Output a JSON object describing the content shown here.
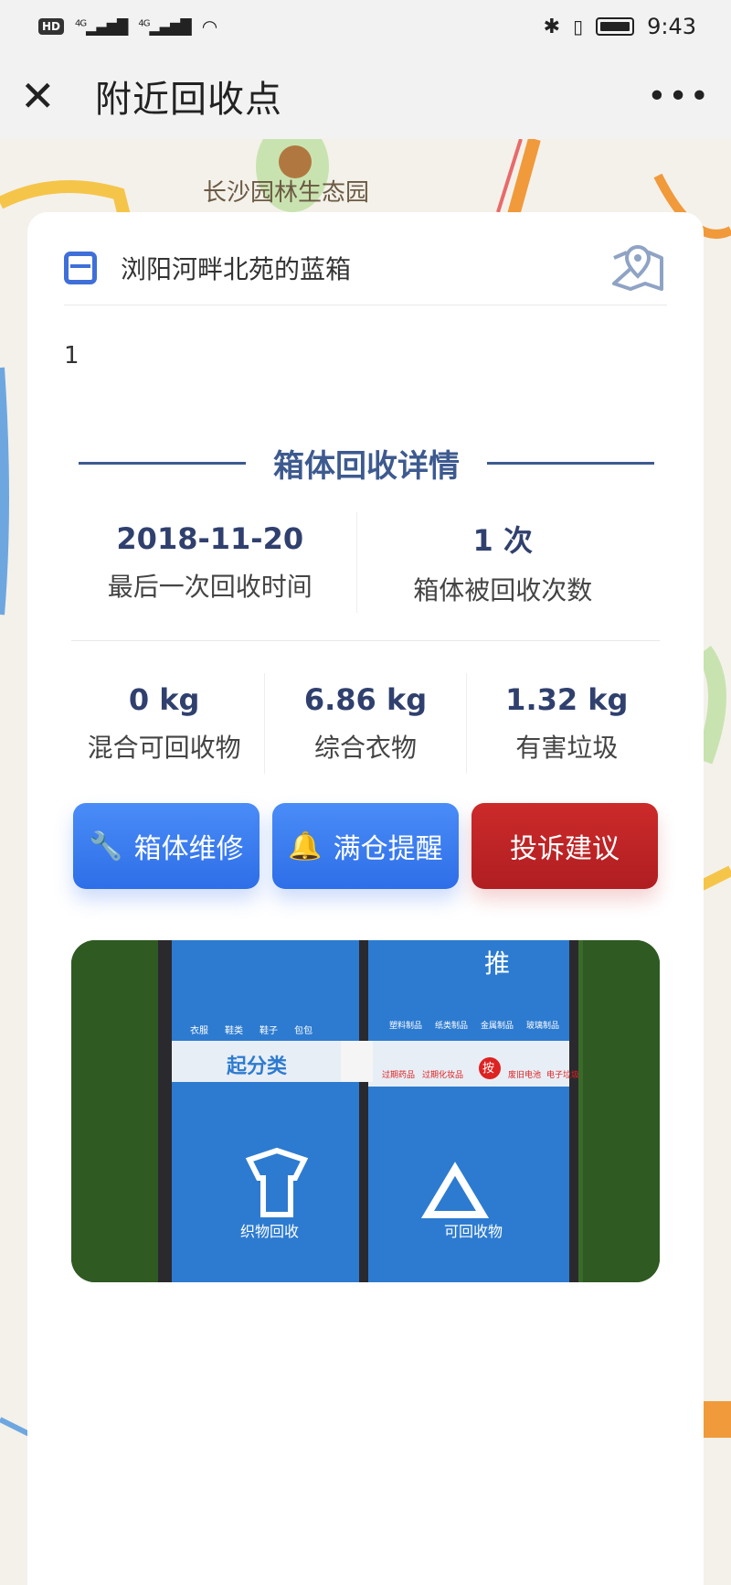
{
  "statusbar": {
    "hd": "HD",
    "signal1": "4G",
    "signal2": "4G",
    "time": "9:43"
  },
  "navbar": {
    "close_icon": "close-icon",
    "title": "附近回收点",
    "more_icon": "more-icon"
  },
  "map": {
    "label_top": "长沙园林生态园"
  },
  "card": {
    "title": "浏阳河畔北苑的蓝箱",
    "description": "1",
    "section_title": "箱体回收详情",
    "stats_primary": [
      {
        "value": "2018-11-20",
        "label": "最后一次回收时间"
      },
      {
        "value": "1 次",
        "label": "箱体被回收次数"
      }
    ],
    "stats_weights": [
      {
        "value": "0 kg",
        "label": "混合可回收物"
      },
      {
        "value": "6.86 kg",
        "label": "综合衣物"
      },
      {
        "value": "1.32 kg",
        "label": "有害垃圾"
      }
    ],
    "buttons": {
      "repair": "箱体维修",
      "full_alert": "满仓提醒",
      "complaint": "投诉建议"
    },
    "photo": {
      "left_panel_text": "起分类",
      "left_bin_label": "织物回收",
      "right_bin_label": "可回收物",
      "push_label": "推",
      "press_label": "按",
      "left_icons": [
        "衣服",
        "鞋类",
        "鞋子",
        "包包"
      ],
      "right_icons": [
        "塑料制品",
        "纸类制品",
        "金属制品",
        "玻璃制品"
      ],
      "hazard_icons": [
        "过期药品",
        "过期化妆品",
        "废旧电池",
        "电子垃圾"
      ]
    }
  },
  "colors": {
    "accent_blue": "#3f6fd8",
    "section_blue": "#3d5a8f",
    "button_blue": "#3a7cf0",
    "button_red": "#c1252a"
  }
}
